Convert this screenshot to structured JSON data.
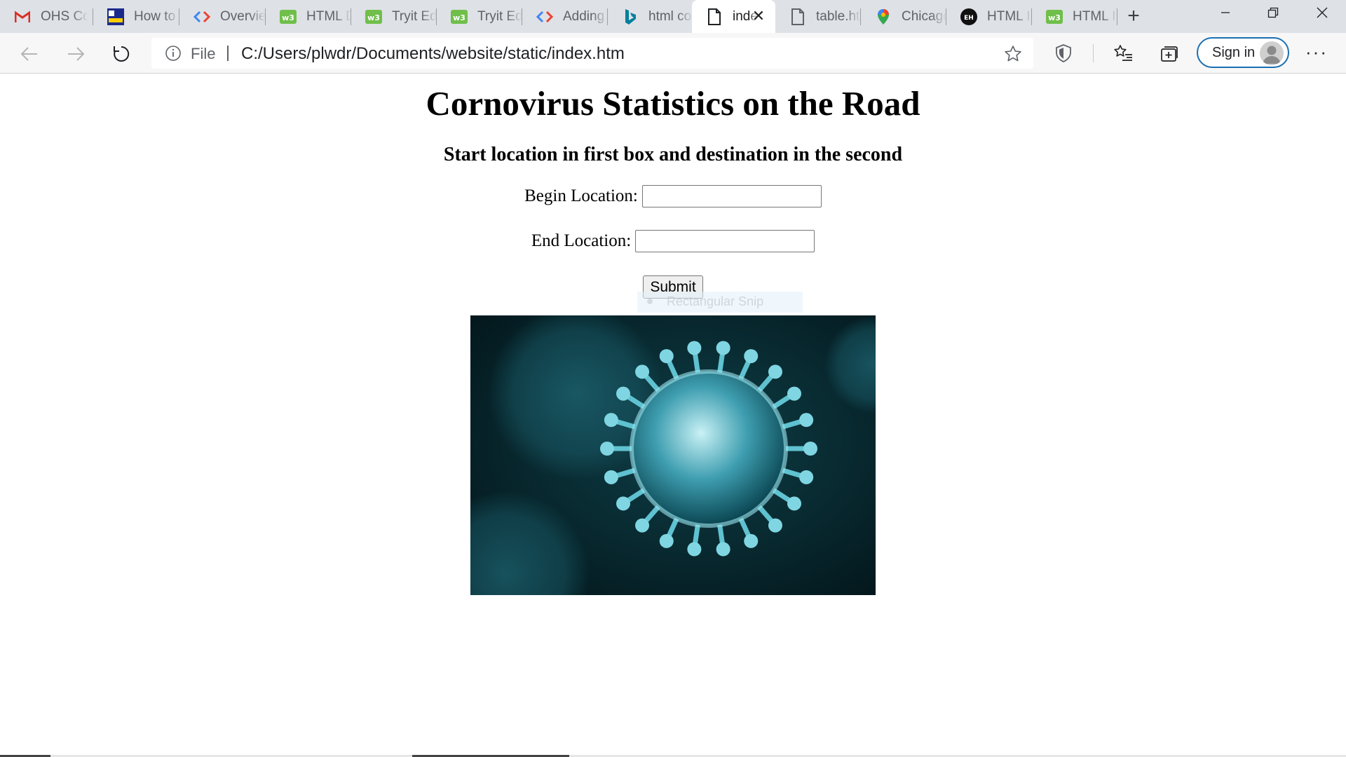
{
  "browser": {
    "tabs": [
      {
        "label": "OHS Co",
        "icon": "gmail-icon"
      },
      {
        "label": "How to I",
        "icon": "wizard-icon"
      },
      {
        "label": "Overview",
        "icon": "code-icon"
      },
      {
        "label": "HTML D",
        "icon": "w3-icon"
      },
      {
        "label": "Tryit Edit",
        "icon": "w3-icon"
      },
      {
        "label": "Tryit Edit",
        "icon": "w3-icon"
      },
      {
        "label": "Adding",
        "icon": "code-icon"
      },
      {
        "label": "html col",
        "icon": "bing-icon"
      },
      {
        "label": "inde",
        "icon": "page-icon",
        "active": true
      },
      {
        "label": "table.htm",
        "icon": "page-icon"
      },
      {
        "label": "Chicago",
        "icon": "maps-pin-icon"
      },
      {
        "label": "HTML In",
        "icon": "eh-icon"
      },
      {
        "label": "HTML In",
        "icon": "w3-icon"
      }
    ],
    "address": {
      "scheme_label": "File",
      "url": "C:/Users/plwdr/Documents/website/static/index.htm"
    },
    "sign_in_label": "Sign in",
    "colors": {
      "tab_strip": "#dee1e6",
      "toolbar": "#f7f7f7",
      "accent": "#1a6fb3"
    }
  },
  "page": {
    "title": "Cornovirus Statistics on the Road",
    "subtitle": "Start location in first box and destination in the second",
    "begin_label": "Begin Location:",
    "begin_value": "",
    "end_label": "End Location:",
    "end_value": "",
    "submit_label": "Submit",
    "overlay_text": "Rectangular Snip"
  }
}
